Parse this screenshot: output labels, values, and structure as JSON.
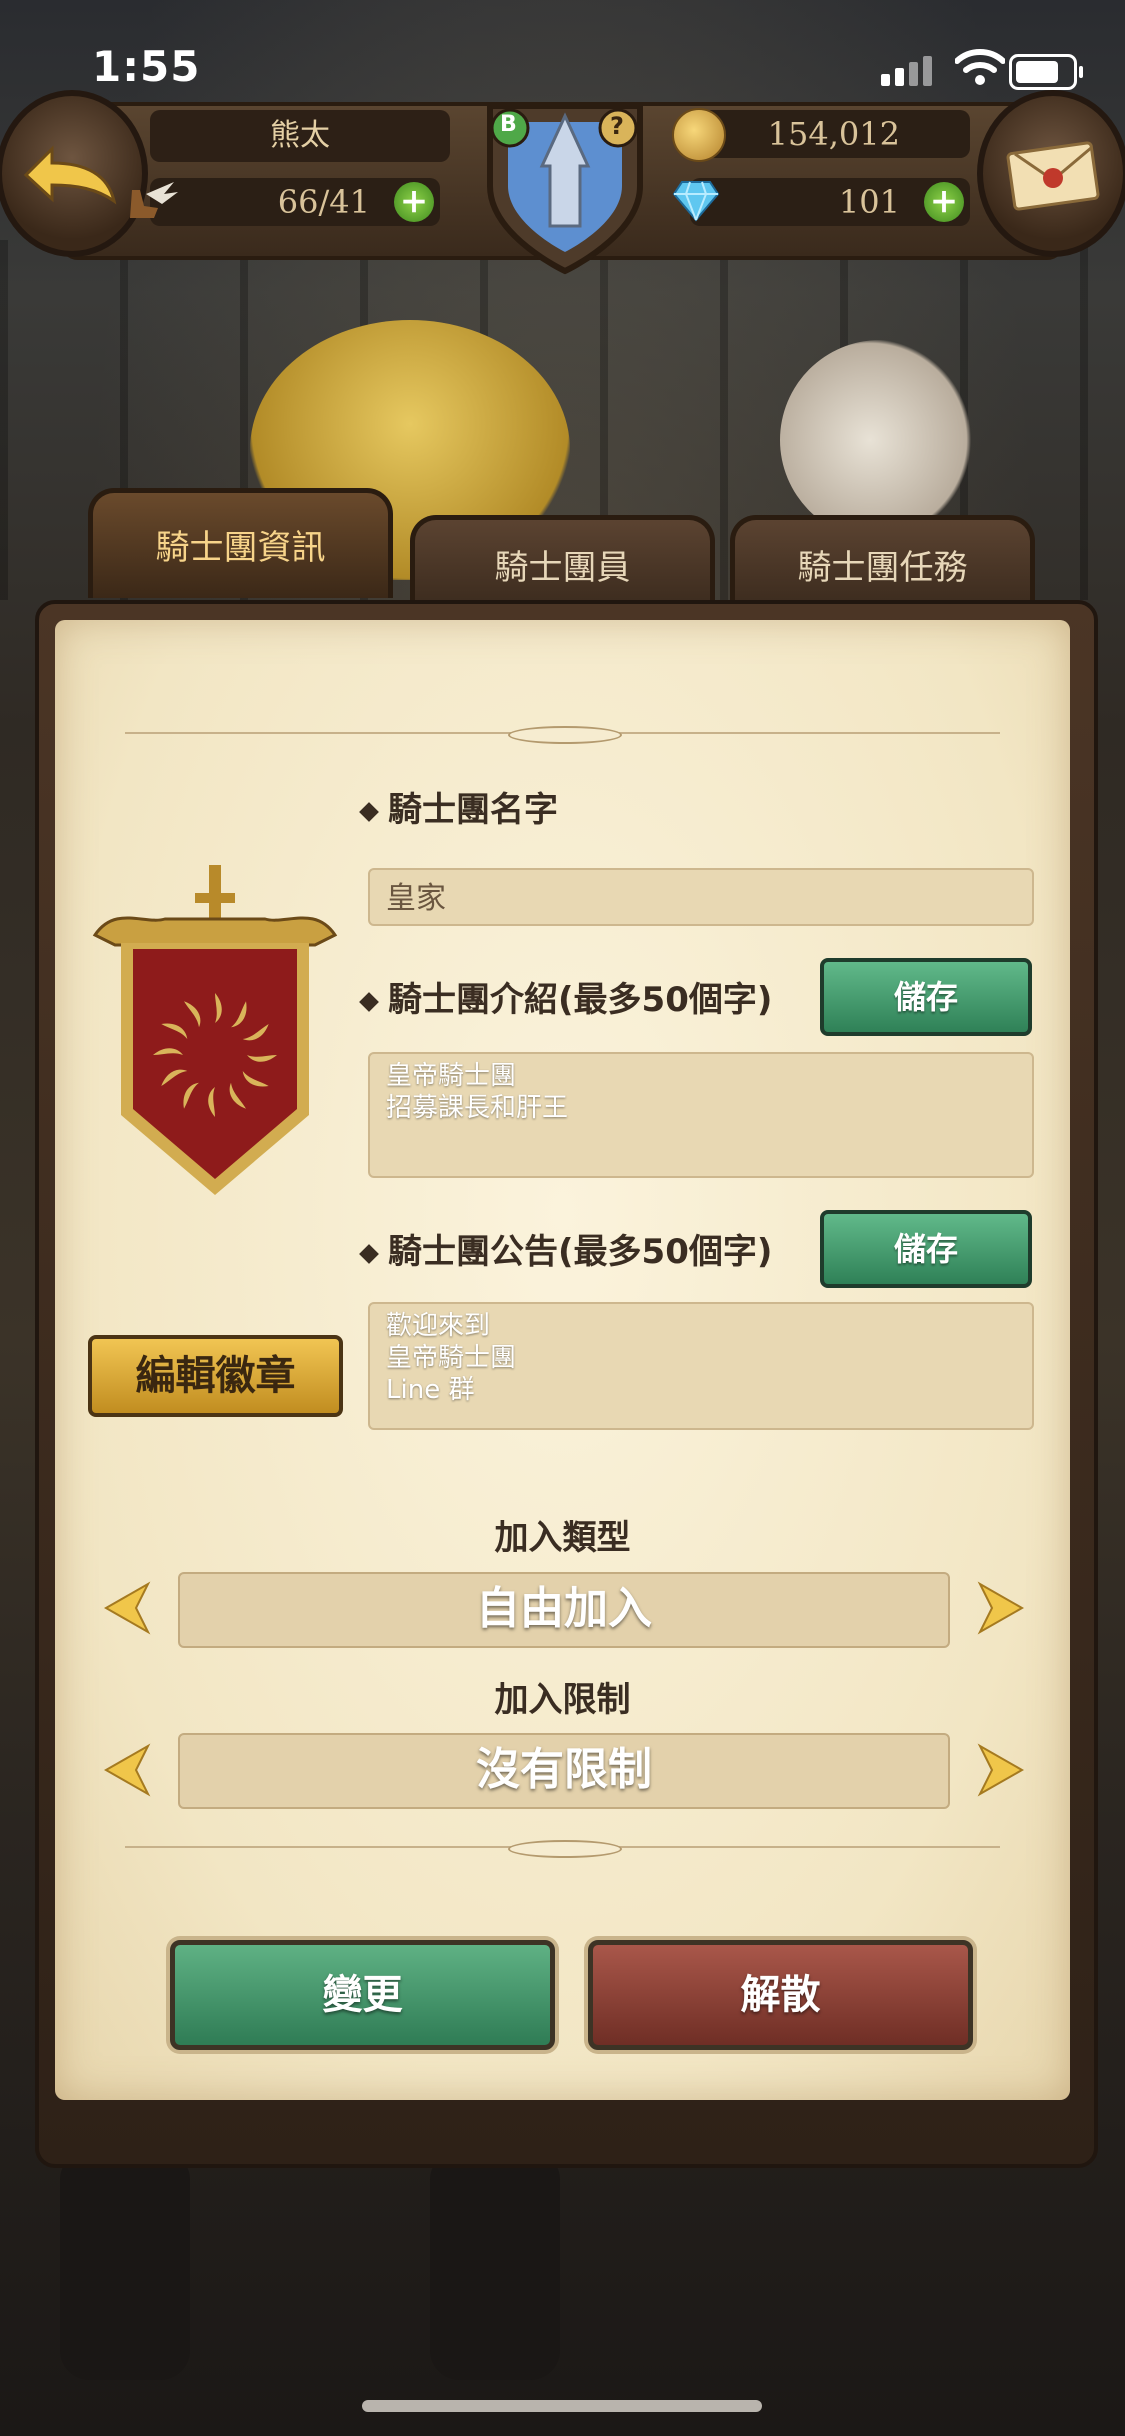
{
  "status_bar": {
    "time": "1:55"
  },
  "hud": {
    "player_name": "熊太",
    "stamina": "66/41",
    "gold": "154,012",
    "gems": "101",
    "crest_badge": "B",
    "crest_help": "?"
  },
  "tabs": [
    {
      "label": "騎士團資訊",
      "active": true
    },
    {
      "label": "騎士團員",
      "active": false
    },
    {
      "label": "騎士團任務",
      "active": false
    }
  ],
  "guild": {
    "name_label": "騎士團名字",
    "name_value": "皇家",
    "intro_label": "騎士團介紹(最多50個字)",
    "intro_value": "皇帝騎士團\n招募課長和肝王",
    "notice_label": "騎士團公告(最多50個字)",
    "notice_value": "歡迎來到\n皇帝騎士團\nLine 群",
    "save_label": "儲存",
    "edit_badge_label": "編輯徽章"
  },
  "join": {
    "type_label": "加入類型",
    "type_value": "自由加入",
    "limit_label": "加入限制",
    "limit_value": "沒有限制"
  },
  "actions": {
    "change": "變更",
    "disband": "解散"
  },
  "colors": {
    "emblem_red": "#8e1b1b",
    "emblem_gold": "#d9b45a",
    "save_green": "#3f9466",
    "disband_red": "#8a3a31"
  }
}
